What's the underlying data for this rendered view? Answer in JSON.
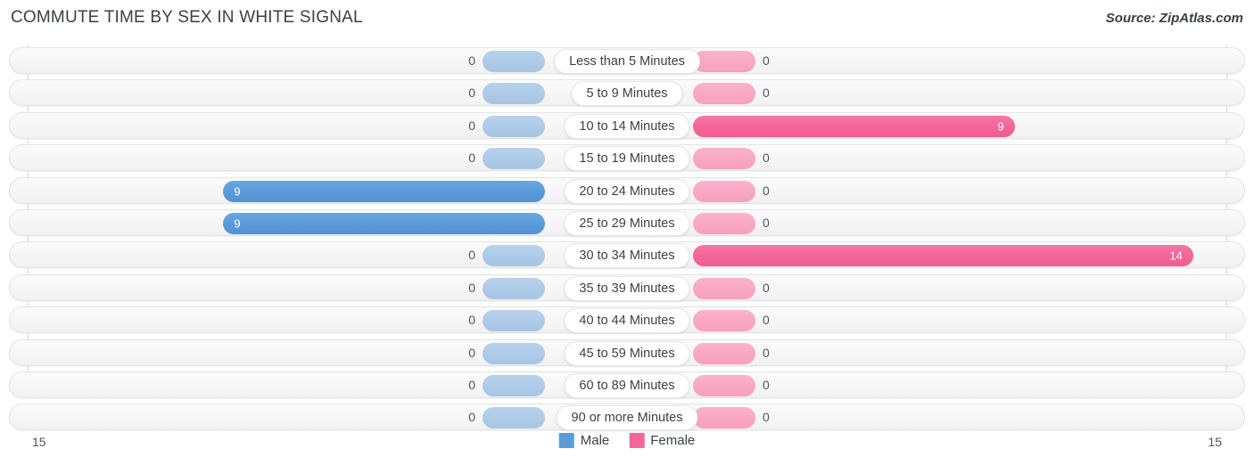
{
  "header": {
    "title": "COMMUTE TIME BY SEX IN WHITE SIGNAL",
    "source": "Source: ZipAtlas.com"
  },
  "axis": {
    "left_label": "15",
    "right_label": "15"
  },
  "legend": {
    "items": [
      {
        "label": "Male",
        "color": "#5b9bd9"
      },
      {
        "label": "Female",
        "color": "#f4669a"
      }
    ]
  },
  "chart_data": {
    "type": "bar",
    "title": "COMMUTE TIME BY SEX IN WHITE SIGNAL",
    "orientation": "horizontal-diverging",
    "xlabel": "",
    "ylabel": "",
    "xlim": [
      15,
      15
    ],
    "grid": true,
    "legend_position": "bottom-center",
    "categories": [
      "Less than 5 Minutes",
      "5 to 9 Minutes",
      "10 to 14 Minutes",
      "15 to 19 Minutes",
      "20 to 24 Minutes",
      "25 to 29 Minutes",
      "30 to 34 Minutes",
      "35 to 39 Minutes",
      "40 to 44 Minutes",
      "45 to 59 Minutes",
      "60 to 89 Minutes",
      "90 or more Minutes"
    ],
    "series": [
      {
        "name": "Male",
        "color": "#5b9bd9",
        "values": [
          0,
          0,
          0,
          0,
          9,
          9,
          0,
          0,
          0,
          0,
          0,
          0
        ]
      },
      {
        "name": "Female",
        "color": "#f4669a",
        "values": [
          0,
          0,
          9,
          0,
          0,
          0,
          14,
          0,
          0,
          0,
          0,
          0
        ]
      }
    ]
  },
  "rows": [
    {
      "label": "Less than 5 Minutes",
      "male": "0",
      "female": "0"
    },
    {
      "label": "5 to 9 Minutes",
      "male": "0",
      "female": "0"
    },
    {
      "label": "10 to 14 Minutes",
      "male": "0",
      "female": "9"
    },
    {
      "label": "15 to 19 Minutes",
      "male": "0",
      "female": "0"
    },
    {
      "label": "20 to 24 Minutes",
      "male": "9",
      "female": "0"
    },
    {
      "label": "25 to 29 Minutes",
      "male": "9",
      "female": "0"
    },
    {
      "label": "30 to 34 Minutes",
      "male": "0",
      "female": "14"
    },
    {
      "label": "35 to 39 Minutes",
      "male": "0",
      "female": "0"
    },
    {
      "label": "40 to 44 Minutes",
      "male": "0",
      "female": "0"
    },
    {
      "label": "45 to 59 Minutes",
      "male": "0",
      "female": "0"
    },
    {
      "label": "60 to 89 Minutes",
      "male": "0",
      "female": "0"
    },
    {
      "label": "90 or more Minutes",
      "male": "0",
      "female": "0"
    }
  ]
}
